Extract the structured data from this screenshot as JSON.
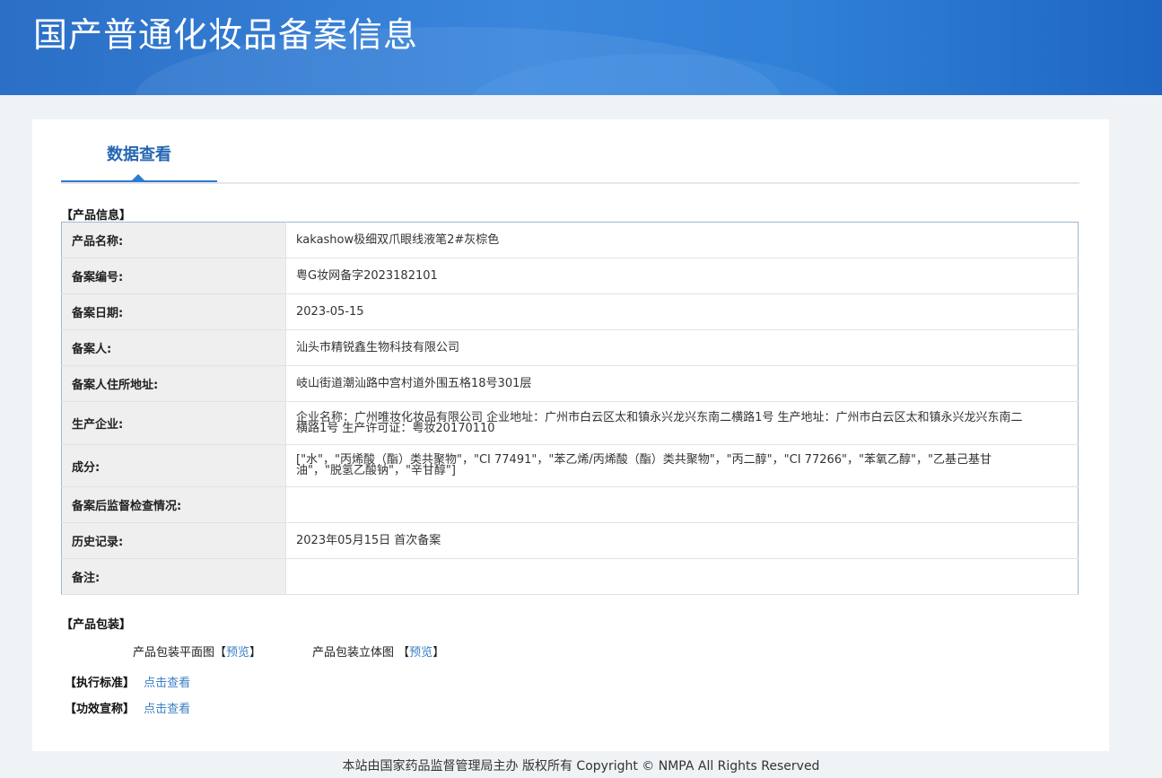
{
  "header": {
    "title": "国产普通化妆品备案信息"
  },
  "tab": {
    "label": "数据查看"
  },
  "product_info": {
    "section_title": "【产品信息】",
    "rows": [
      {
        "key": "产品名称:",
        "value": "kakashow极细双爪眼线液笔2#灰棕色"
      },
      {
        "key": "备案编号:",
        "value": "粤G妆网备字2023182101"
      },
      {
        "key": "备案日期:",
        "value": "2023-05-15"
      },
      {
        "key": "备案人:",
        "value": "汕头市精锐鑫生物科技有限公司"
      },
      {
        "key": "备案人住所地址:",
        "value": "岐山街道潮汕路中宫村道外围五格18号301层"
      },
      {
        "key": "生产企业:",
        "value": "企业名称：广州唯妆化妆品有限公司 企业地址：广州市白云区太和镇永兴龙兴东南二横路1号 生产地址：广州市白云区太和镇永兴龙兴东南二横路1号 生产许可证：粤妆20170110"
      },
      {
        "key": "成分:",
        "value": "[\"水\"，\"丙烯酸（酯）类共聚物\"，\"CI 77491\"，\"苯乙烯/丙烯酸（酯）类共聚物\"，\"丙二醇\"，\"CI 77266\"，\"苯氧乙醇\"，\"乙基己基甘油\"，\"脱氢乙酸钠\"，\"辛甘醇\"]"
      },
      {
        "key": "备案后监督检查情况:",
        "value": ""
      },
      {
        "key": "历史记录:",
        "value": "2023年05月15日 首次备案"
      },
      {
        "key": "备注:",
        "value": ""
      }
    ]
  },
  "packaging": {
    "section_title": "【产品包装】",
    "flat_label": "产品包装平面图",
    "flat_link": "预览",
    "solid_label": "产品包装立体图",
    "solid_link": "预览",
    "bracket_open": "【",
    "bracket_close": "】"
  },
  "standard": {
    "section_title": "【执行标准】",
    "link": "点击查看"
  },
  "efficacy": {
    "section_title": "【功效宣称】",
    "link": "点击查看"
  },
  "footer": {
    "text": "本站由国家药品监督管理局主办 版权所有 Copyright © NMPA All Rights Reserved"
  }
}
